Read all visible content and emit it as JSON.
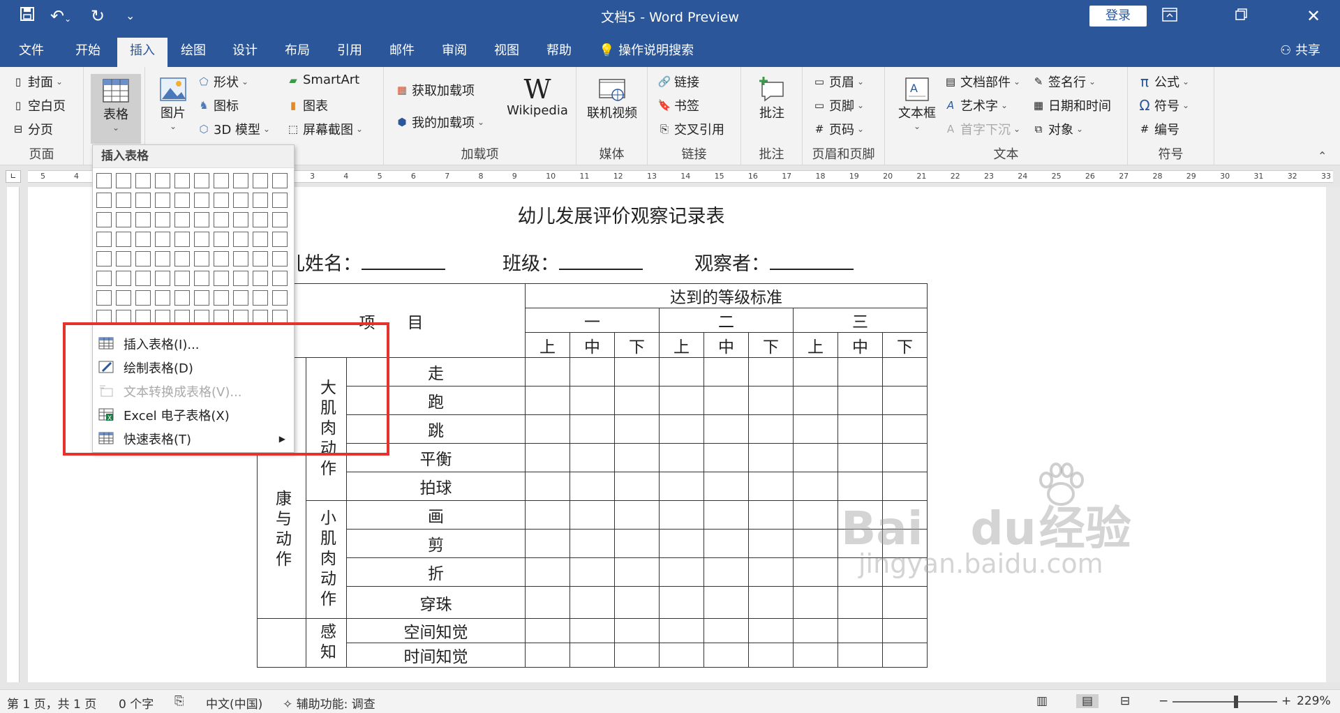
{
  "app": {
    "title": "文档5  -  Word Preview",
    "login_label": "登录",
    "share_label": "共享"
  },
  "tabs": [
    {
      "label": "文件"
    },
    {
      "label": "开始"
    },
    {
      "label": "插入"
    },
    {
      "label": "绘图"
    },
    {
      "label": "设计"
    },
    {
      "label": "布局"
    },
    {
      "label": "引用"
    },
    {
      "label": "邮件"
    },
    {
      "label": "审阅"
    },
    {
      "label": "视图"
    },
    {
      "label": "帮助"
    },
    {
      "label": "操作说明搜索"
    }
  ],
  "ribbon": {
    "pages": {
      "cover": "封面",
      "blank": "空白页",
      "break": "分页",
      "label": "页面"
    },
    "table_btn": "表格",
    "illus": {
      "picture": "图片",
      "shapes": "形状",
      "icons": "图标",
      "model3d": "3D 模型",
      "smartart": "SmartArt",
      "chart": "图表",
      "screenshot": "屏幕截图"
    },
    "addins": {
      "get": "获取加载项",
      "my": "我的加载项",
      "wiki": "Wikipedia",
      "label": "加载项"
    },
    "media": {
      "video": "联机视频",
      "label": "媒体"
    },
    "links": {
      "link": "链接",
      "bookmark": "书签",
      "crossref": "交叉引用",
      "label": "链接"
    },
    "comments": {
      "comment": "批注",
      "label": "批注"
    },
    "hf": {
      "header": "页眉",
      "footer": "页脚",
      "pagenum": "页码",
      "label": "页眉和页脚"
    },
    "text": {
      "textbox": "文本框",
      "parts": "文档部件",
      "wordart": "艺术字",
      "dropcap": "首字下沉",
      "sigline": "签名行",
      "datetime": "日期和时间",
      "object": "对象",
      "label": "文本"
    },
    "symbols": {
      "equation": "公式",
      "symbol": "符号",
      "number": "编号",
      "label": "符号"
    }
  },
  "dropdown": {
    "header": "插入表格",
    "items": [
      {
        "label": "插入表格(I)...",
        "disabled": false
      },
      {
        "label": "绘制表格(D)",
        "disabled": false
      },
      {
        "label": "文本转换成表格(V)...",
        "disabled": true
      },
      {
        "label": "Excel 电子表格(X)",
        "disabled": false
      },
      {
        "label": "快速表格(T)",
        "disabled": false
      }
    ]
  },
  "document": {
    "title": "幼儿发展评价观察记录表",
    "field_child": "儿姓名：",
    "field_class": "班级：",
    "field_observer": "观察者：",
    "table": {
      "header_item": "项　　目",
      "header_level": "达到的等级标准",
      "levels": [
        "一",
        "二",
        "三"
      ],
      "grades": [
        "上",
        "中",
        "下",
        "上",
        "中",
        "下",
        "上",
        "中",
        "下"
      ],
      "domain1": "康与动作",
      "sub1": "大肌肉动作",
      "sub2": "小肌肉动作",
      "sub3": "感知",
      "rows1": [
        "走",
        "跑",
        "跳",
        "平衡",
        "拍球"
      ],
      "rows2": [
        "画",
        "剪",
        "折",
        "穿珠"
      ],
      "rows3": [
        "空间知觉",
        "时间知觉"
      ]
    }
  },
  "ruler": {
    "left_nums": [
      "5",
      "4"
    ],
    "nums": [
      "3",
      "4",
      "5",
      "6",
      "7",
      "8",
      "9",
      "10",
      "11",
      "12",
      "13",
      "14",
      "15",
      "16",
      "17",
      "18",
      "19",
      "20",
      "21",
      "22",
      "23",
      "24",
      "25",
      "26",
      "27",
      "28",
      "29",
      "30",
      "31",
      "32",
      "33"
    ]
  },
  "status": {
    "page": "第 1 页，共 1 页",
    "words": "0 个字",
    "lang": "中文(中国)",
    "access": "辅助功能: 调查",
    "zoom": "229%"
  },
  "watermark": {
    "brand": "Bai",
    "brand2": "du",
    "cn": "经验",
    "url": "jingyan.baidu.com"
  },
  "colors": {
    "accent": "#2b579a",
    "highlight": "#e5322d"
  }
}
